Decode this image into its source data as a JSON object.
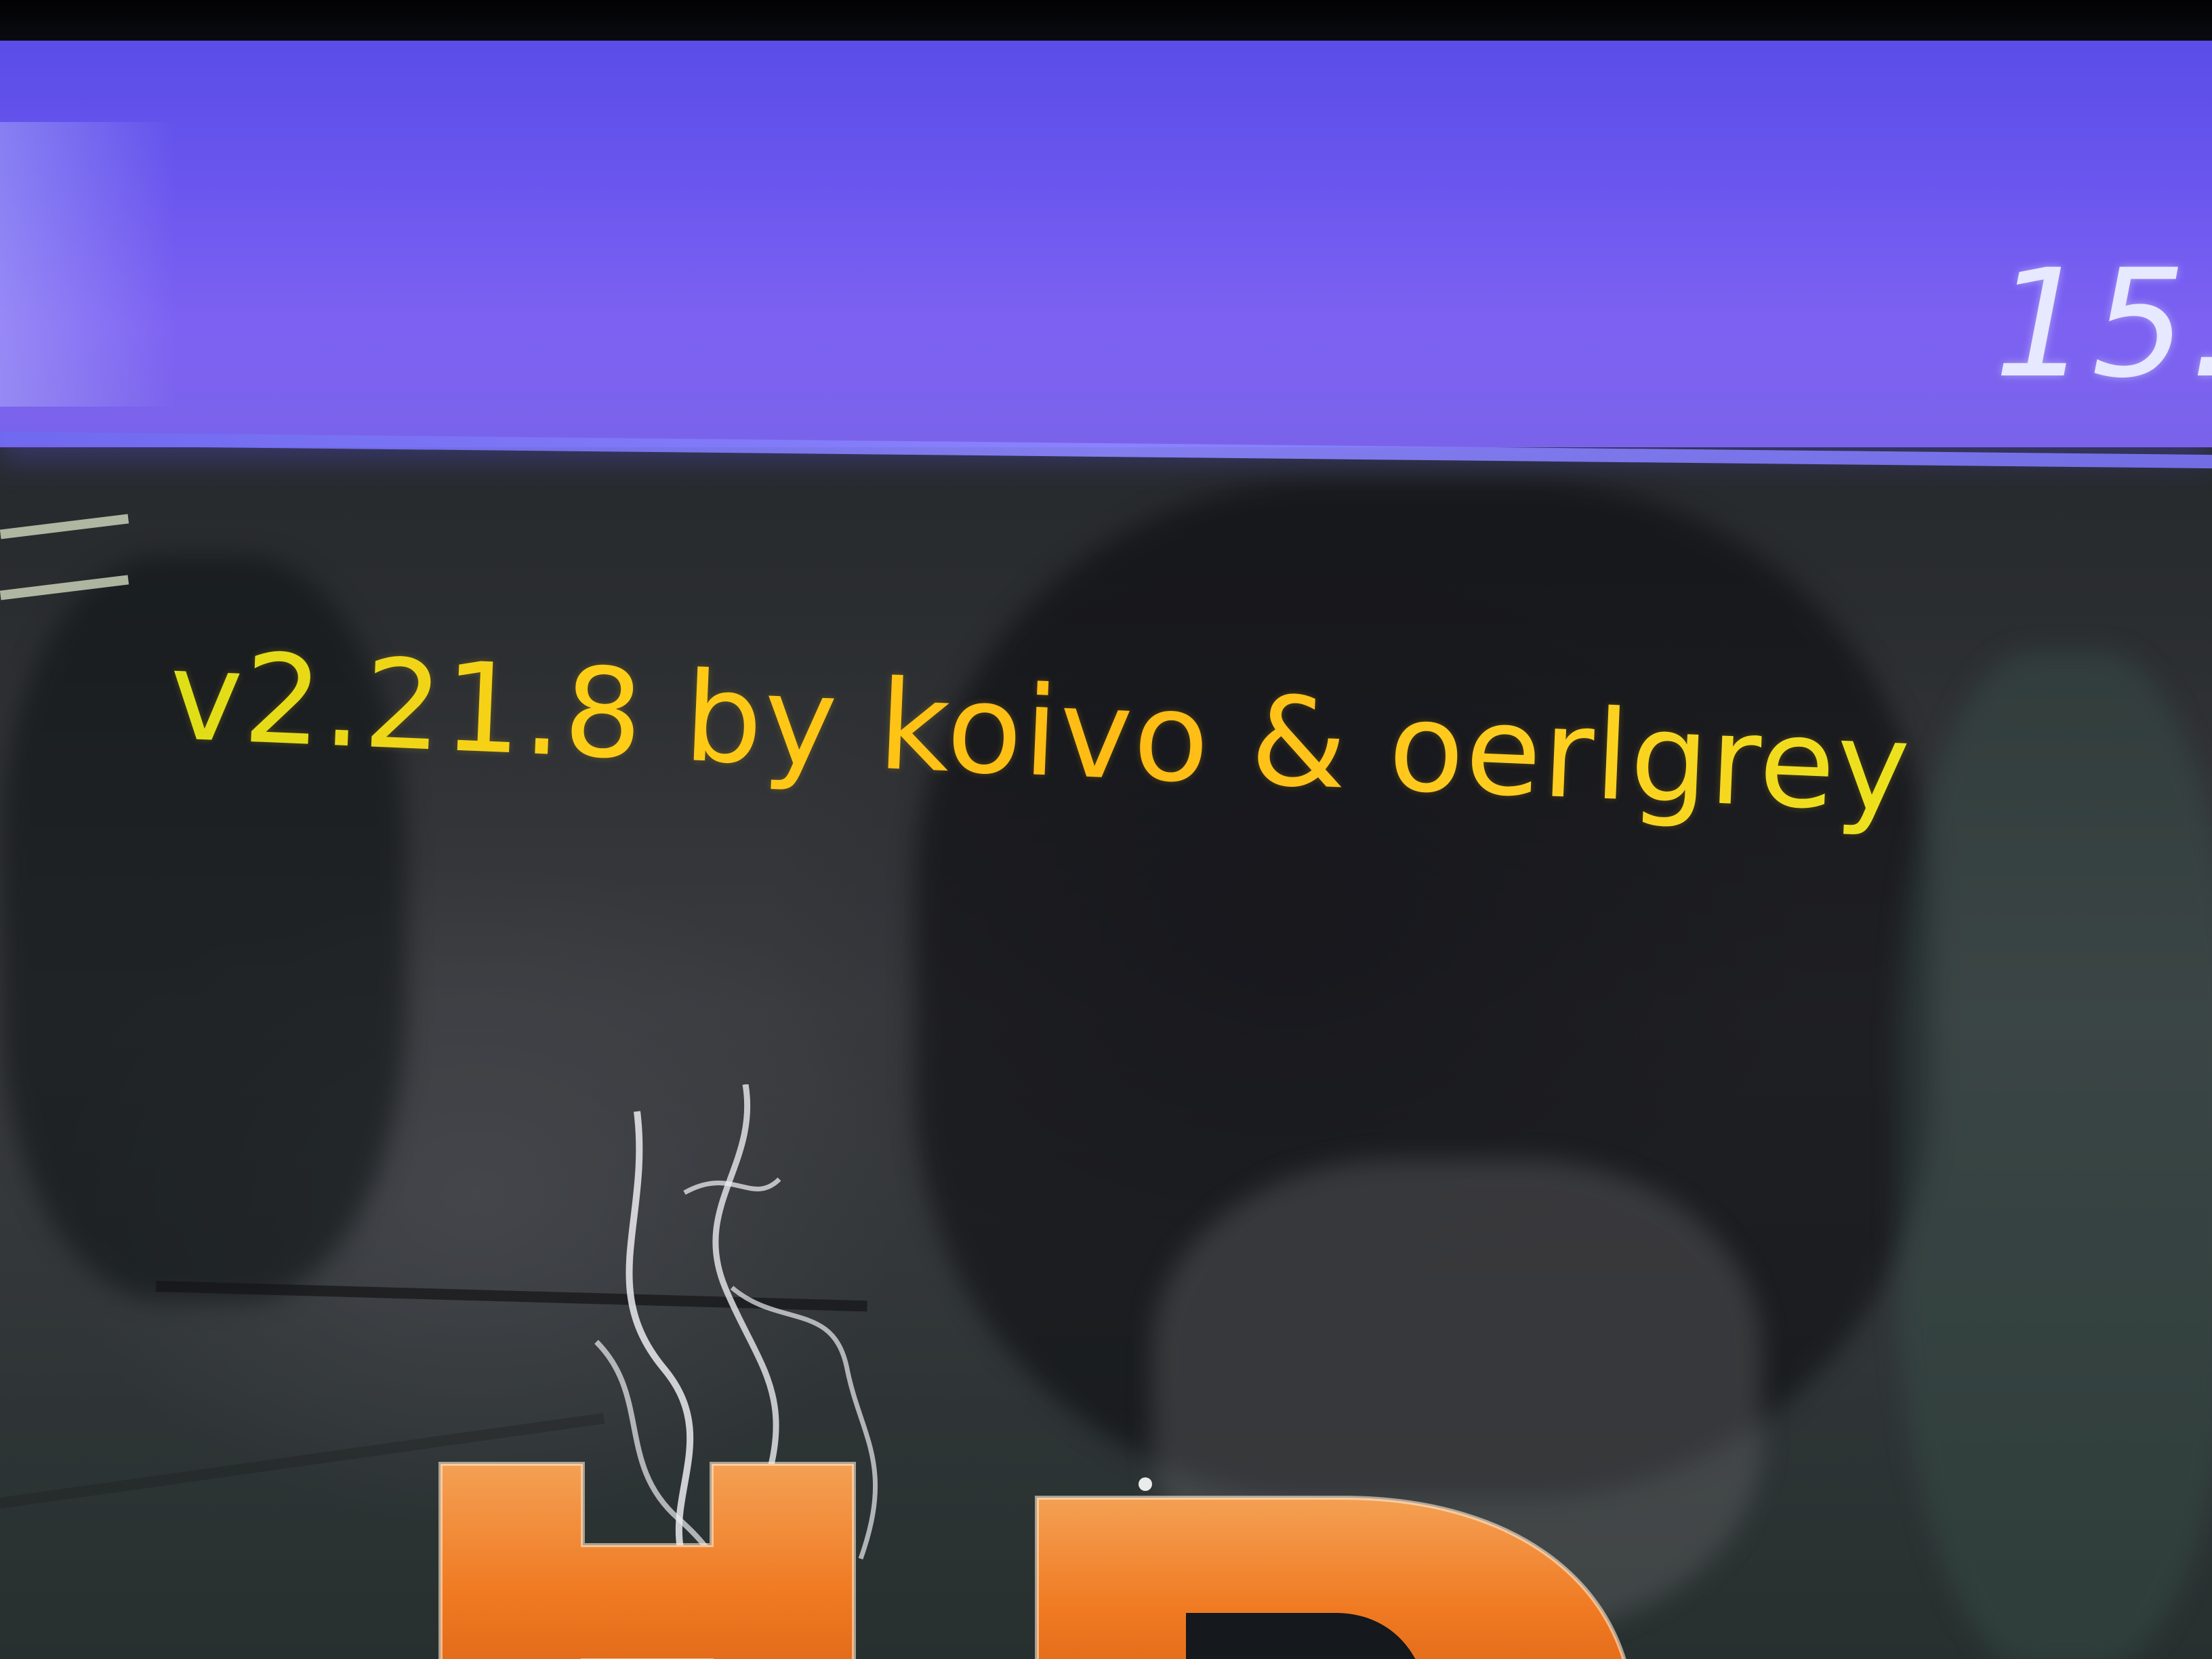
{
  "status_bar": {
    "clock_partial": "15."
  },
  "splash": {
    "version_text": "v2.21.8 by koivo & oerlgrey",
    "logo_label": "HD"
  },
  "colors": {
    "status_bar": "#6a56ee",
    "version_text": "#ffc81c",
    "logo_orange": "#f07a22",
    "clock_text": "#e6e9ff"
  }
}
